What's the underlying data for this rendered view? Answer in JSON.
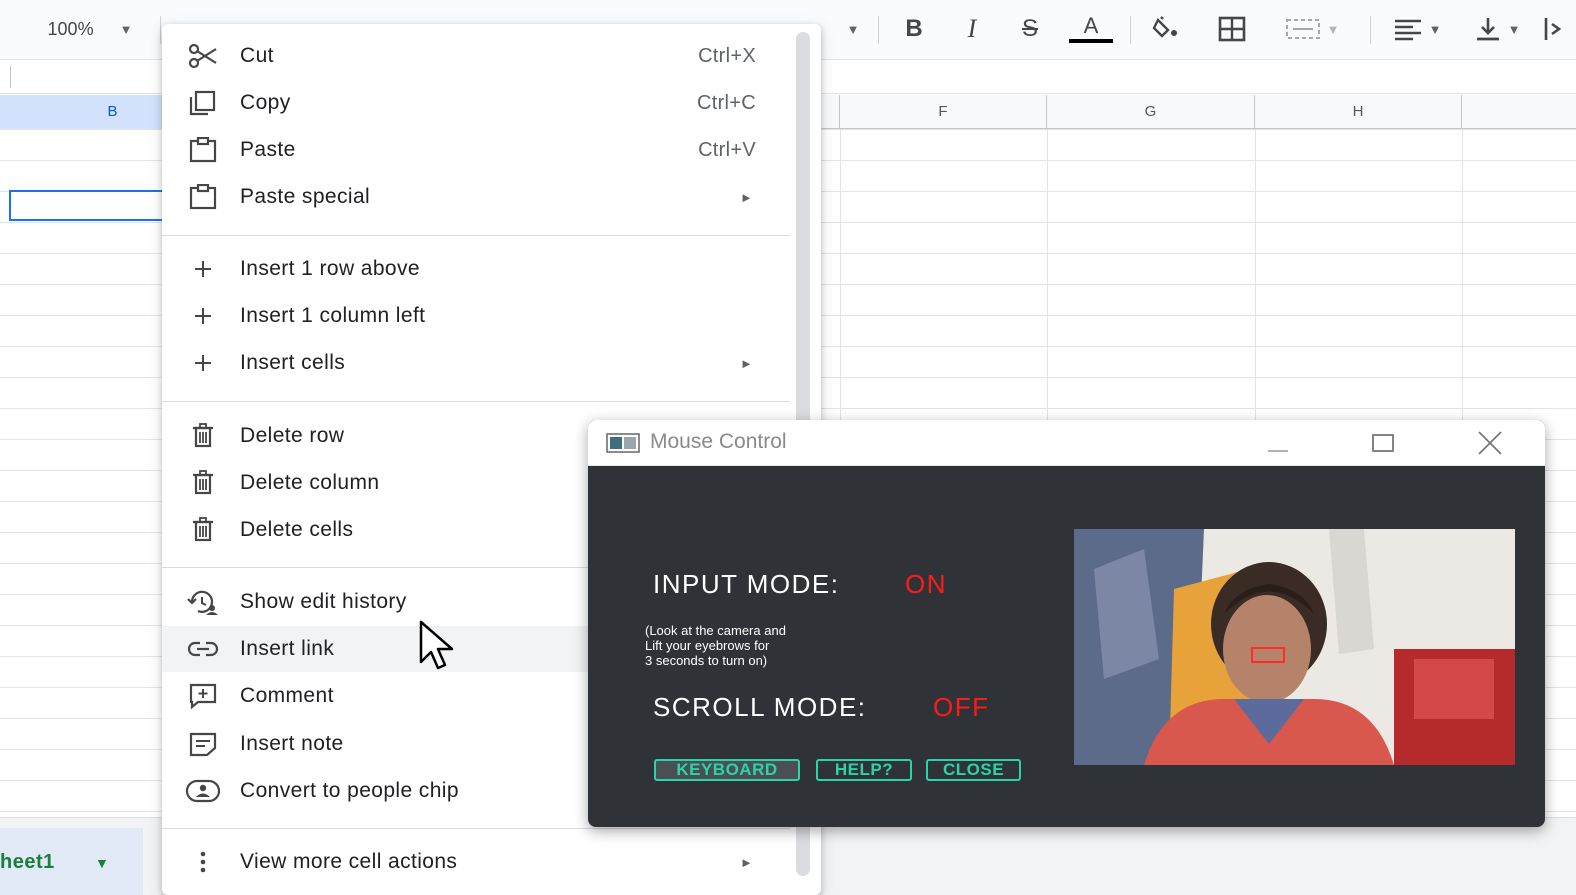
{
  "toolbar": {
    "zoom": "100%",
    "bold_label": "B",
    "italic_label": "I",
    "strike_label": "S",
    "text_color_label": "A"
  },
  "columns": {
    "b": "B",
    "f": "F",
    "g": "G",
    "h": "H"
  },
  "sheet_tab": {
    "label": "heet1"
  },
  "context_menu": {
    "items": [
      {
        "label": "Cut",
        "shortcut": "Ctrl+X",
        "icon": "scissors-icon"
      },
      {
        "label": "Copy",
        "shortcut": "Ctrl+C",
        "icon": "copy-icon"
      },
      {
        "label": "Paste",
        "shortcut": "Ctrl+V",
        "icon": "clipboard-icon"
      },
      {
        "label": "Paste special",
        "icon": "clipboard-icon",
        "submenu": true
      },
      {
        "label": "Insert 1 row above",
        "icon": "plus-icon"
      },
      {
        "label": "Insert 1 column left",
        "icon": "plus-icon"
      },
      {
        "label": "Insert cells",
        "icon": "plus-icon",
        "submenu": true
      },
      {
        "label": "Delete row",
        "icon": "trash-icon"
      },
      {
        "label": "Delete column",
        "icon": "trash-icon"
      },
      {
        "label": "Delete cells",
        "icon": "trash-icon"
      },
      {
        "label": "Show edit history",
        "icon": "history-icon"
      },
      {
        "label": "Insert link",
        "icon": "link-icon",
        "hovered": true
      },
      {
        "label": "Comment",
        "icon": "comment-icon"
      },
      {
        "label": "Insert note",
        "icon": "note-icon"
      },
      {
        "label": "Convert to people chip",
        "icon": "people-chip-icon"
      },
      {
        "label": "View more cell actions",
        "icon": "more-vert-icon",
        "submenu": true
      }
    ],
    "submenu_arrow": "►"
  },
  "mouse_control": {
    "title": "Mouse Control",
    "input_mode_label": "INPUT MODE:",
    "input_mode_value": "ON",
    "hint": "(Look at the camera and\nLift your eyebrows for\n3 seconds to turn on)",
    "scroll_mode_label": "SCROLL MODE:",
    "scroll_mode_value": "OFF",
    "buttons": {
      "keyboard": "KEYBOARD",
      "help": "HELP?",
      "close": "CLOSE"
    },
    "colors": {
      "value_red": "#ff1a1a",
      "button_teal": "#2bd3a8",
      "panel_bg": "#2f3337"
    }
  }
}
